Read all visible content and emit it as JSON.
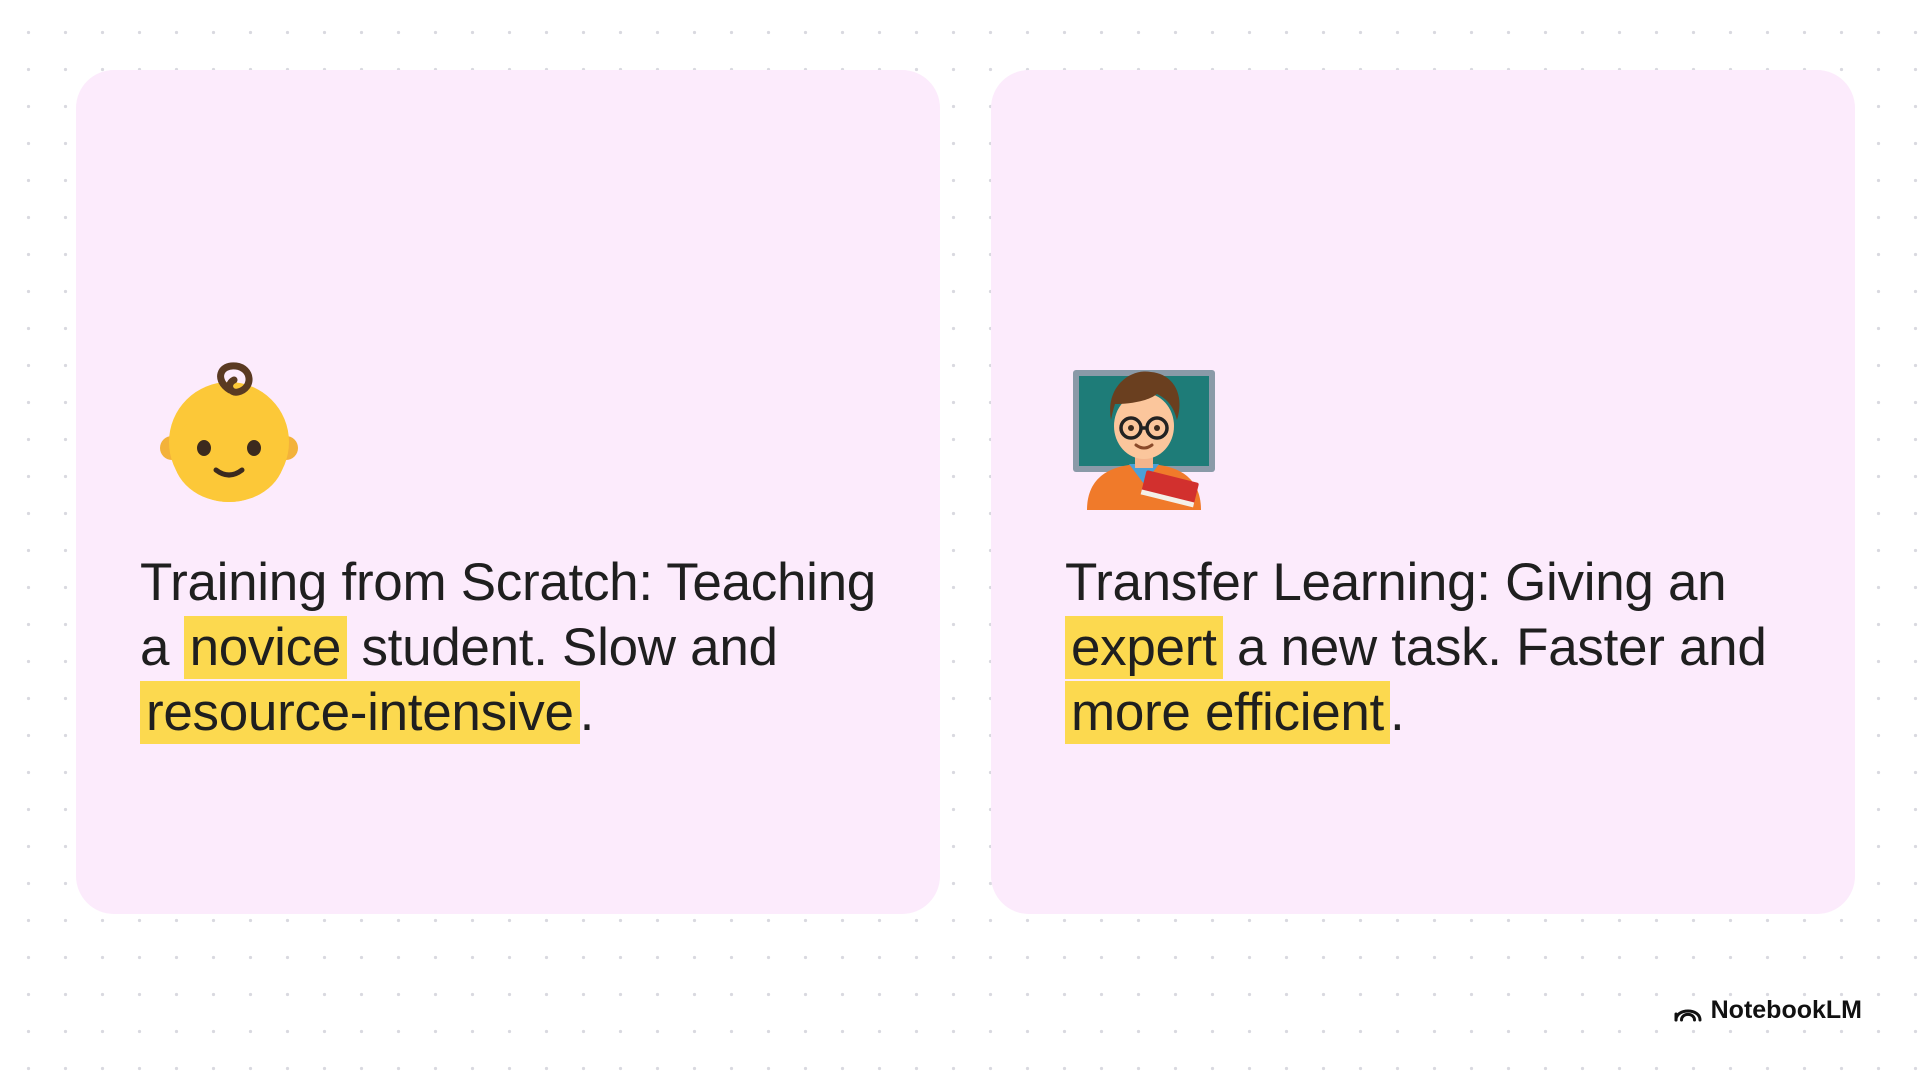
{
  "cards": [
    {
      "icon": "baby-face-icon",
      "segments": [
        {
          "text": "Training from Scratch: Teaching a ",
          "highlight": false
        },
        {
          "text": "novice",
          "highlight": true
        },
        {
          "text": " student. Slow and ",
          "highlight": false
        },
        {
          "text": "resource-intensive",
          "highlight": true
        },
        {
          "text": ".",
          "highlight": false
        }
      ]
    },
    {
      "icon": "teacher-icon",
      "segments": [
        {
          "text": "Transfer Learning: Giving an ",
          "highlight": false
        },
        {
          "text": "expert",
          "highlight": true
        },
        {
          "text": " a new task. Faster and ",
          "highlight": false
        },
        {
          "text": "more efficient",
          "highlight": true
        },
        {
          "text": ".",
          "highlight": false
        }
      ]
    }
  ],
  "brand": {
    "name": "NotebookLM",
    "icon": "notebooklm-logo-icon"
  },
  "colors": {
    "card_background": "#fcebfc",
    "highlight": "#fcd94f",
    "text": "#1f1f1f",
    "page_background": "#ffffff"
  }
}
